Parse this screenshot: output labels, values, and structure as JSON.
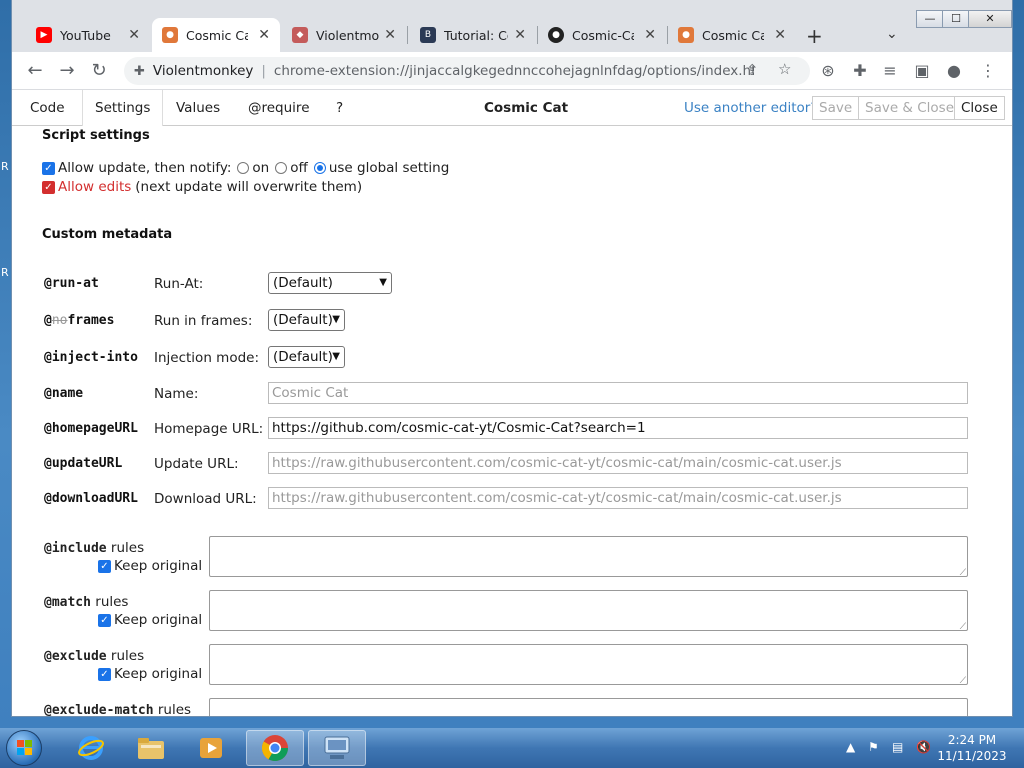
{
  "window_buttons": [
    "—",
    "☐",
    "✕"
  ],
  "tabs": [
    {
      "title": "YouTube",
      "favicon": "youtube-icon",
      "favicon_color": "#ff0000"
    },
    {
      "title": "Cosmic Cat",
      "favicon": "cosmic-cat-icon",
      "favicon_color": "#e0783a",
      "active": true
    },
    {
      "title": "Violentmonkey",
      "favicon": "violentmonkey-icon",
      "favicon_color": "#c45b5b"
    },
    {
      "title": "Tutorial: Configuring",
      "favicon": "bit-icon",
      "favicon_color": "#2b3a55"
    },
    {
      "title": "Cosmic-Cat",
      "favicon": "github-icon",
      "favicon_color": "#222222"
    },
    {
      "title": "Cosmic Cat",
      "favicon": "cosmic-cat-icon",
      "favicon_color": "#e0783a"
    }
  ],
  "new_tab": "+",
  "omnibox": {
    "site": "Violentmonkey",
    "url": "chrome-extension://jinjaccalgkegednnccohejagnlnfdag/options/index.html..."
  },
  "editor": {
    "tabs": [
      "Code",
      "Settings",
      "Values",
      "@require",
      "?"
    ],
    "title": "Cosmic Cat",
    "other_editor": "Use another editor?",
    "save": "Save",
    "save_close": "Save & Close",
    "close": "Close"
  },
  "settings": {
    "heading": "Script settings",
    "allow_update": "Allow update, then notify:",
    "radio_on": "on",
    "radio_off": "off",
    "radio_global": "use global setting",
    "allow_edits": "Allow edits",
    "allow_edits_note": "(next update will overwrite them)",
    "custom_heading": "Custom metadata"
  },
  "meta": {
    "run_at": {
      "key": "@run-at",
      "label": "Run-At:",
      "value": "(Default)"
    },
    "noframes": {
      "key_prefix": "@",
      "key_strike": "no",
      "key_rest": "frames",
      "label": "Run in frames:",
      "value": "(Default)"
    },
    "inject_into": {
      "key": "@inject-into",
      "label": "Injection mode:",
      "value": "(Default)"
    },
    "name": {
      "key": "@name",
      "label": "Name:",
      "placeholder": "Cosmic Cat"
    },
    "homepage": {
      "key": "@homepageURL",
      "label": "Homepage URL:",
      "value": "https://github.com/cosmic-cat-yt/Cosmic-Cat?search=1"
    },
    "update": {
      "key": "@updateURL",
      "label": "Update URL:",
      "placeholder": "https://raw.githubusercontent.com/cosmic-cat-yt/cosmic-cat/main/cosmic-cat.user.js"
    },
    "download": {
      "key": "@downloadURL",
      "label": "Download URL:",
      "placeholder": "https://raw.githubusercontent.com/cosmic-cat-yt/cosmic-cat/main/cosmic-cat.user.js"
    }
  },
  "rules": [
    {
      "key": "@include",
      "suffix": "rules",
      "keep": "Keep original"
    },
    {
      "key": "@match",
      "suffix": "rules",
      "keep": "Keep original"
    },
    {
      "key": "@exclude",
      "suffix": "rules",
      "keep": "Keep original"
    },
    {
      "key": "@exclude-match",
      "suffix": "rules"
    }
  ],
  "taskbar": {
    "time": "2:24 PM",
    "date": "11/11/2023"
  },
  "desktop_letters": [
    "R",
    "R"
  ]
}
